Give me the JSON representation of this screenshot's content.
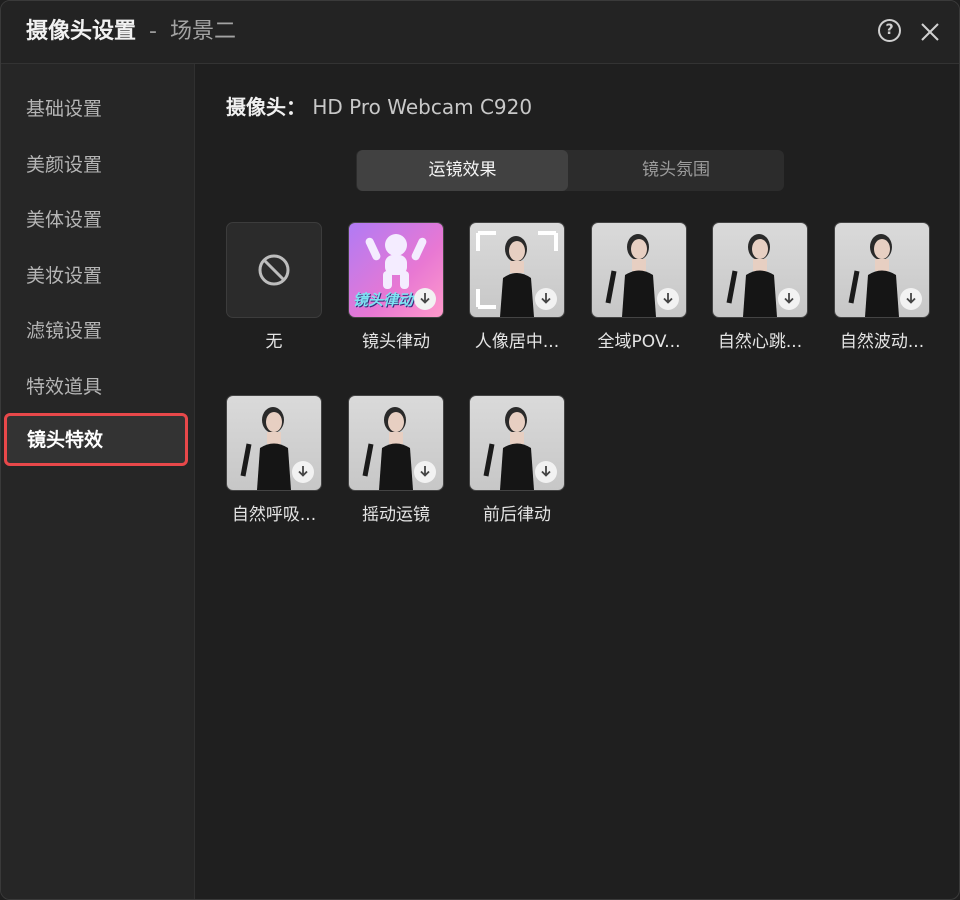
{
  "window": {
    "title": "摄像头设置",
    "title_separator": "-",
    "scene": "场景二"
  },
  "sidebar": {
    "items": [
      {
        "label": "基础设置"
      },
      {
        "label": "美颜设置"
      },
      {
        "label": "美体设置"
      },
      {
        "label": "美妆设置"
      },
      {
        "label": "滤镜设置"
      },
      {
        "label": "特效道具"
      },
      {
        "label": "镜头特效"
      }
    ],
    "active_index": 6
  },
  "camera": {
    "label": "摄像头：",
    "value": "HD Pro Webcam C920"
  },
  "tabs": [
    {
      "label": "运镜效果",
      "selected": true
    },
    {
      "label": "镜头氛围",
      "selected": false
    }
  ],
  "effects": [
    {
      "label": "无",
      "icon": "no-entry-icon"
    },
    {
      "label": "镜头律动",
      "overlay_text": "镜头律动",
      "icon": "download-icon"
    },
    {
      "label": "人像居中...",
      "icon": "download-icon"
    },
    {
      "label": "全域POV...",
      "icon": "download-icon"
    },
    {
      "label": "自然心跳...",
      "icon": "download-icon"
    },
    {
      "label": "自然波动...",
      "icon": "download-icon"
    },
    {
      "label": "自然呼吸...",
      "icon": "download-icon"
    },
    {
      "label": "摇动运镜",
      "icon": "download-icon"
    },
    {
      "label": "前后律动",
      "icon": "download-icon"
    }
  ],
  "colors": {
    "accent_red": "#e8484a",
    "background": "#1f1f1f",
    "sidebar": "#262626"
  }
}
